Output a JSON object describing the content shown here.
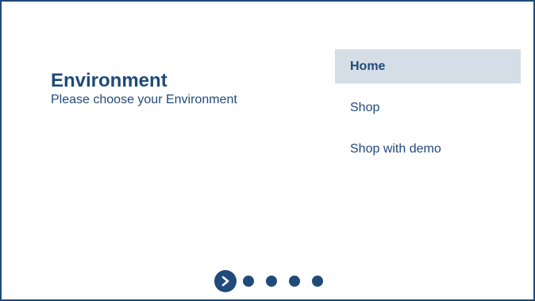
{
  "header": {
    "title": "Environment",
    "subtitle": "Please choose your Environment"
  },
  "menu": {
    "items": [
      {
        "label": "Home",
        "selected": true
      },
      {
        "label": "Shop",
        "selected": false
      },
      {
        "label": "Shop with demo",
        "selected": false
      }
    ]
  },
  "pager": {
    "total_steps": 5,
    "current_step": 1,
    "current_icon": "chevron-right-icon"
  },
  "colors": {
    "primary": "#1f4a7a",
    "selected_background": "#d5dde6",
    "background": "#ffffff"
  }
}
